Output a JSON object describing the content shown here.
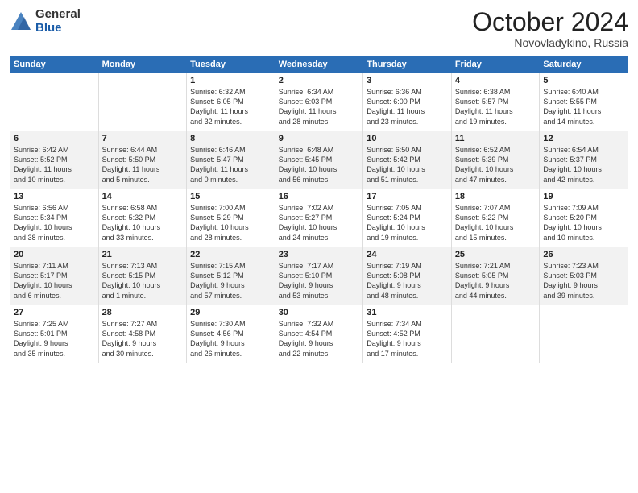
{
  "header": {
    "logo_general": "General",
    "logo_blue": "Blue",
    "month": "October 2024",
    "location": "Novovladykino, Russia"
  },
  "weekdays": [
    "Sunday",
    "Monday",
    "Tuesday",
    "Wednesday",
    "Thursday",
    "Friday",
    "Saturday"
  ],
  "rows": [
    [
      {
        "day": "",
        "lines": []
      },
      {
        "day": "",
        "lines": []
      },
      {
        "day": "1",
        "lines": [
          "Sunrise: 6:32 AM",
          "Sunset: 6:05 PM",
          "Daylight: 11 hours",
          "and 32 minutes."
        ]
      },
      {
        "day": "2",
        "lines": [
          "Sunrise: 6:34 AM",
          "Sunset: 6:03 PM",
          "Daylight: 11 hours",
          "and 28 minutes."
        ]
      },
      {
        "day": "3",
        "lines": [
          "Sunrise: 6:36 AM",
          "Sunset: 6:00 PM",
          "Daylight: 11 hours",
          "and 23 minutes."
        ]
      },
      {
        "day": "4",
        "lines": [
          "Sunrise: 6:38 AM",
          "Sunset: 5:57 PM",
          "Daylight: 11 hours",
          "and 19 minutes."
        ]
      },
      {
        "day": "5",
        "lines": [
          "Sunrise: 6:40 AM",
          "Sunset: 5:55 PM",
          "Daylight: 11 hours",
          "and 14 minutes."
        ]
      }
    ],
    [
      {
        "day": "6",
        "lines": [
          "Sunrise: 6:42 AM",
          "Sunset: 5:52 PM",
          "Daylight: 11 hours",
          "and 10 minutes."
        ]
      },
      {
        "day": "7",
        "lines": [
          "Sunrise: 6:44 AM",
          "Sunset: 5:50 PM",
          "Daylight: 11 hours",
          "and 5 minutes."
        ]
      },
      {
        "day": "8",
        "lines": [
          "Sunrise: 6:46 AM",
          "Sunset: 5:47 PM",
          "Daylight: 11 hours",
          "and 0 minutes."
        ]
      },
      {
        "day": "9",
        "lines": [
          "Sunrise: 6:48 AM",
          "Sunset: 5:45 PM",
          "Daylight: 10 hours",
          "and 56 minutes."
        ]
      },
      {
        "day": "10",
        "lines": [
          "Sunrise: 6:50 AM",
          "Sunset: 5:42 PM",
          "Daylight: 10 hours",
          "and 51 minutes."
        ]
      },
      {
        "day": "11",
        "lines": [
          "Sunrise: 6:52 AM",
          "Sunset: 5:39 PM",
          "Daylight: 10 hours",
          "and 47 minutes."
        ]
      },
      {
        "day": "12",
        "lines": [
          "Sunrise: 6:54 AM",
          "Sunset: 5:37 PM",
          "Daylight: 10 hours",
          "and 42 minutes."
        ]
      }
    ],
    [
      {
        "day": "13",
        "lines": [
          "Sunrise: 6:56 AM",
          "Sunset: 5:34 PM",
          "Daylight: 10 hours",
          "and 38 minutes."
        ]
      },
      {
        "day": "14",
        "lines": [
          "Sunrise: 6:58 AM",
          "Sunset: 5:32 PM",
          "Daylight: 10 hours",
          "and 33 minutes."
        ]
      },
      {
        "day": "15",
        "lines": [
          "Sunrise: 7:00 AM",
          "Sunset: 5:29 PM",
          "Daylight: 10 hours",
          "and 28 minutes."
        ]
      },
      {
        "day": "16",
        "lines": [
          "Sunrise: 7:02 AM",
          "Sunset: 5:27 PM",
          "Daylight: 10 hours",
          "and 24 minutes."
        ]
      },
      {
        "day": "17",
        "lines": [
          "Sunrise: 7:05 AM",
          "Sunset: 5:24 PM",
          "Daylight: 10 hours",
          "and 19 minutes."
        ]
      },
      {
        "day": "18",
        "lines": [
          "Sunrise: 7:07 AM",
          "Sunset: 5:22 PM",
          "Daylight: 10 hours",
          "and 15 minutes."
        ]
      },
      {
        "day": "19",
        "lines": [
          "Sunrise: 7:09 AM",
          "Sunset: 5:20 PM",
          "Daylight: 10 hours",
          "and 10 minutes."
        ]
      }
    ],
    [
      {
        "day": "20",
        "lines": [
          "Sunrise: 7:11 AM",
          "Sunset: 5:17 PM",
          "Daylight: 10 hours",
          "and 6 minutes."
        ]
      },
      {
        "day": "21",
        "lines": [
          "Sunrise: 7:13 AM",
          "Sunset: 5:15 PM",
          "Daylight: 10 hours",
          "and 1 minute."
        ]
      },
      {
        "day": "22",
        "lines": [
          "Sunrise: 7:15 AM",
          "Sunset: 5:12 PM",
          "Daylight: 9 hours",
          "and 57 minutes."
        ]
      },
      {
        "day": "23",
        "lines": [
          "Sunrise: 7:17 AM",
          "Sunset: 5:10 PM",
          "Daylight: 9 hours",
          "and 53 minutes."
        ]
      },
      {
        "day": "24",
        "lines": [
          "Sunrise: 7:19 AM",
          "Sunset: 5:08 PM",
          "Daylight: 9 hours",
          "and 48 minutes."
        ]
      },
      {
        "day": "25",
        "lines": [
          "Sunrise: 7:21 AM",
          "Sunset: 5:05 PM",
          "Daylight: 9 hours",
          "and 44 minutes."
        ]
      },
      {
        "day": "26",
        "lines": [
          "Sunrise: 7:23 AM",
          "Sunset: 5:03 PM",
          "Daylight: 9 hours",
          "and 39 minutes."
        ]
      }
    ],
    [
      {
        "day": "27",
        "lines": [
          "Sunrise: 7:25 AM",
          "Sunset: 5:01 PM",
          "Daylight: 9 hours",
          "and 35 minutes."
        ]
      },
      {
        "day": "28",
        "lines": [
          "Sunrise: 7:27 AM",
          "Sunset: 4:58 PM",
          "Daylight: 9 hours",
          "and 30 minutes."
        ]
      },
      {
        "day": "29",
        "lines": [
          "Sunrise: 7:30 AM",
          "Sunset: 4:56 PM",
          "Daylight: 9 hours",
          "and 26 minutes."
        ]
      },
      {
        "day": "30",
        "lines": [
          "Sunrise: 7:32 AM",
          "Sunset: 4:54 PM",
          "Daylight: 9 hours",
          "and 22 minutes."
        ]
      },
      {
        "day": "31",
        "lines": [
          "Sunrise: 7:34 AM",
          "Sunset: 4:52 PM",
          "Daylight: 9 hours",
          "and 17 minutes."
        ]
      },
      {
        "day": "",
        "lines": []
      },
      {
        "day": "",
        "lines": []
      }
    ]
  ]
}
